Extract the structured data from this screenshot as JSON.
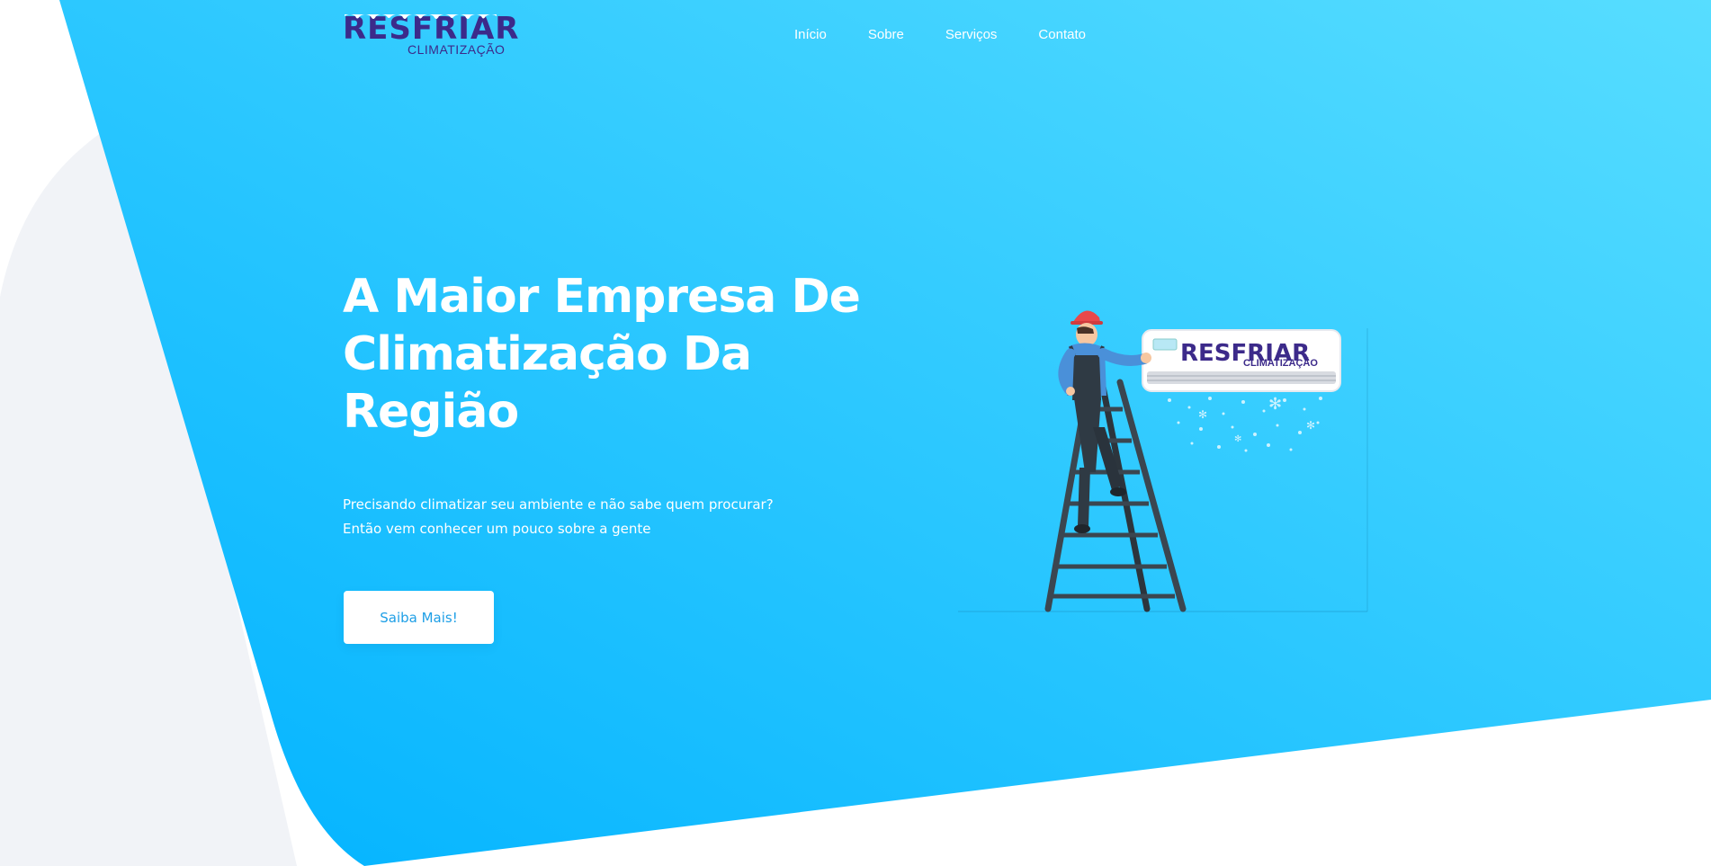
{
  "brand": {
    "name": "RESFRIAR",
    "subtitle": "CLIMATIZAÇÃO"
  },
  "nav": {
    "items": [
      {
        "label": "Início"
      },
      {
        "label": "Sobre"
      },
      {
        "label": "Serviços"
      },
      {
        "label": "Contato"
      }
    ]
  },
  "hero": {
    "title_line1": "A Maior Empresa De",
    "title_line2": "Climatização Da",
    "title_line3": "Região",
    "text_line1": "Precisando climatizar seu ambiente e não sabe quem procurar?",
    "text_line2": "Então vem conhecer um pouco sobre a gente",
    "button_label": "Saiba Mais!"
  },
  "illustration": {
    "ac_brand": "RESFRIAR",
    "ac_subtitle": "CLIMATIZAÇÃO"
  },
  "colors": {
    "hero_gradient_start": "#00b2ff",
    "hero_gradient_end": "#55dcff",
    "left_panel_gray": "#f1f3f7",
    "brand_purple": "#3c2a8a",
    "button_text": "#1e9fe6"
  }
}
